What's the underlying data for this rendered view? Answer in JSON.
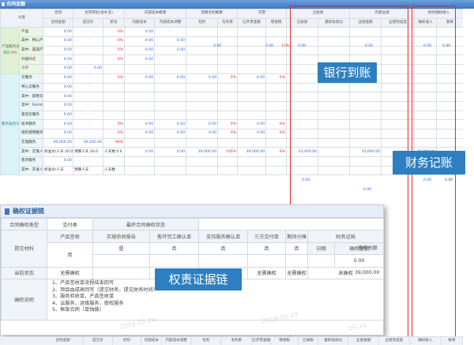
{
  "sheet": {
    "title": "合同金额",
    "header_groups": [
      "分类",
      "合同",
      "合同审批(含补充)",
      "内部成本概算",
      "测算毛利概算",
      "开票",
      "已收款",
      "内部业绩",
      "财务确权收入"
    ],
    "sub_headers": [
      "合同金额",
      "成交价",
      "折扣",
      "内部成本",
      "内部成本调整",
      "毛利",
      "毛利率",
      "已开票金额",
      "增值税",
      "已收款",
      "最新收款比",
      "业绩金额",
      "业绩完成度",
      "确权收入",
      "税率"
    ],
    "bottom_headers": [
      "合同金额",
      "成交价",
      "折扣",
      "内部成本",
      "内部成本调整",
      "毛利",
      "毛利率",
      "已开票金额",
      "增值税",
      "已收款",
      "最新收款比",
      "业绩金额",
      "业绩完成度",
      "确权收入",
      "税率"
    ],
    "categories": {
      "product": "产品服务合计",
      "product_rate_label": "点比:",
      "product_rate": "0%",
      "service": "服务类合计"
    },
    "rows": [
      {
        "label": "产品",
        "type": "g",
        "v": [
          "0.00",
          "-",
          "0%",
          "0.00",
          "-",
          "",
          "",
          "",
          "",
          "",
          "",
          "",
          "",
          "",
          ""
        ]
      },
      {
        "label": "其中：特心产品",
        "type": "g",
        "v": [
          "0.00",
          "-",
          "0%",
          "0.00",
          "0.00",
          "",
          "",
          "",
          "",
          "",
          "",
          "",
          "",
          "",
          ""
        ]
      },
      {
        "label": "其中：渠道产品",
        "type": "g",
        "v": [
          "0.00",
          "-",
          "0%",
          "0.00",
          "0.00",
          "",
          "",
          "",
          "",
          "",
          "",
          "",
          "",
          "",
          ""
        ]
      },
      {
        "label": "升级升迁",
        "type": "g",
        "v": [
          "0.00",
          "",
          "0%",
          "0.00",
          "",
          "",
          "",
          "",
          "",
          "",
          "",
          "",
          "",
          "",
          ""
        ]
      },
      {
        "label": "小计",
        "type": "g",
        "v": [
          "0.00",
          "0.00",
          "",
          "",
          "",
          "",
          "",
          "",
          "",
          "",
          "",
          "",
          "",
          "",
          ""
        ]
      },
      {
        "label": "云服务",
        "type": "c",
        "v": [
          "0.00",
          "-",
          "0%",
          "0.00",
          "0.00",
          "0.00",
          "0%",
          "0.00",
          "6%",
          "",
          "",
          "",
          "",
          "",
          ""
        ]
      },
      {
        "label": "特心云服务",
        "type": "c",
        "v": [
          "0.00",
          "-",
          "",
          "",
          "",
          "",
          "",
          "",
          "",
          "",
          "",
          "",
          "",
          "",
          ""
        ]
      },
      {
        "label": "其中：薪税云",
        "type": "c",
        "v": [
          "0.00",
          "-",
          "",
          "",
          "",
          "",
          "",
          "",
          "",
          "",
          "",
          "",
          "",
          "",
          ""
        ]
      },
      {
        "label": "其中：Formtalk",
        "type": "c",
        "v": [
          "0.00",
          "-",
          "",
          "",
          "",
          "",
          "",
          "",
          "",
          "",
          "",
          "",
          "",
          "",
          ""
        ]
      },
      {
        "label": "渠道云服务",
        "type": "c",
        "v": [
          "0.00",
          "-",
          "",
          "",
          "",
          "",
          "",
          "",
          "",
          "",
          "",
          "",
          "",
          "",
          ""
        ]
      },
      {
        "label": "技术服务",
        "type": "c",
        "v": [
          "0.00",
          "-",
          "0%",
          "0.00",
          "0.00",
          "0.00",
          "0%",
          "0.00",
          "6%",
          "",
          "",
          "",
          "",
          "",
          ""
        ]
      },
      {
        "label": "授权使用服务",
        "type": "c",
        "v": [
          "0.00",
          "-",
          "0%",
          "0.00",
          "0.00",
          "0.00",
          "0%",
          "0.00",
          "6%",
          "",
          "",
          "",
          "",
          "",
          ""
        ]
      },
      {
        "label": "实施服务",
        "type": "c",
        "v": [
          "40,000.00",
          "39,000.00",
          "98%",
          "",
          "",
          "",
          "",
          "",
          "",
          "",
          "",
          "",
          "",
          "",
          ""
        ]
      },
      {
        "label": "其中：实施人天",
        "type": "c",
        "v": [
          "标准价/人天 20.0",
          "预算人天 20.0",
          "人天数 0.0",
          "0.00",
          "0.00",
          "39,000.00",
          "100%",
          "39,000.00",
          "6%",
          "23,400.00",
          "",
          "15,600.00",
          "",
          "39,000.00",
          ""
        ]
      },
      {
        "label": "客开服务",
        "type": "c",
        "v": [
          "0.00",
          "-",
          "",
          "",
          "",
          "",
          "",
          "",
          "",
          "",
          "",
          "",
          "",
          "",
          ""
        ]
      },
      {
        "label": "其中：开发人天",
        "type": "c",
        "v": [
          "标准价/人天",
          "预算人天",
          "人天数",
          "",
          "",
          "",
          "",
          "",
          "",
          "",
          "",
          "",
          "",
          "",
          ""
        ]
      }
    ],
    "inline_values": {
      "product_profit": "0.00",
      "product_margin": "13%",
      "product_invoice": "0.00",
      "product_received": "0.00",
      "product_perf": "0.00",
      "product_recognized": "0.00",
      "product_tax": "0.00",
      "service_received_a": "0.00",
      "service_received_b": "0.00",
      "service_perf_a": "0.00",
      "service_perf_b": "0.00",
      "service_recog_a": "0.00",
      "service_recog_b": "0.00",
      "service_tax": "0.00"
    }
  },
  "callouts": {
    "bank": "银行到账",
    "finance": "财务记账",
    "rights": "权责证据链"
  },
  "panel": {
    "title": "确权证据链",
    "row1": {
      "c1": "合同确权类型",
      "c2": "交付类",
      "c3": "最终合同确权状态"
    },
    "headers": [
      "产品签收",
      "实施验收报告",
      "客开完工确认单",
      "支持服务确认单",
      "三方交付单",
      "期间分摊",
      "财务记账"
    ],
    "submit_label": "提交材料",
    "submit_values": {
      "product": "否",
      "impl": "是",
      "custom": "否",
      "support": "否",
      "third": "否",
      "period": "否"
    },
    "finance_sub": {
      "date_label": "日期",
      "amount_label": "确权金额",
      "total_label": "确权总额",
      "amount": "0.00",
      "total": "39,000.00"
    },
    "status_label": "当前状态",
    "status_values": {
      "product": "无需确权",
      "impl": "",
      "third": "无需确权",
      "period": "无需确权",
      "finance": "未确权"
    },
    "explain_label": "确权说明",
    "explain_lines": [
      "1、产品签收单流程结束回写",
      "2、项目血成表回写（提交财务，提交财务时间）",
      "3、服务验收单，产品签收单",
      "4、云服务，运维服务，授权服务",
      "5、框架合同（单独做）"
    ],
    "watermarks": [
      "2019-05-24",
      "2019-05-24",
      "05-24"
    ]
  }
}
